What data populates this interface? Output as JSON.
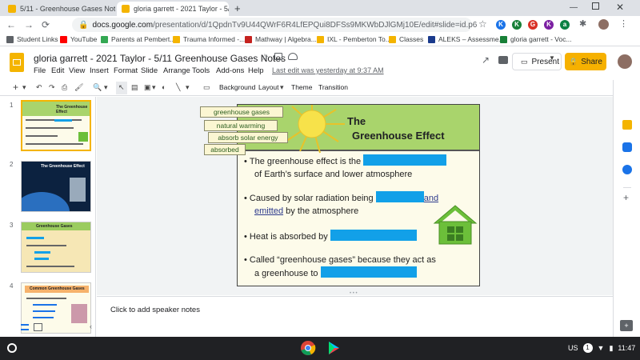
{
  "browser": {
    "tabs": [
      {
        "label": "5/11 - Greenhouse Gases Notes",
        "close": "×",
        "favicon_color": "#f4b400"
      },
      {
        "label": "gloria garrett - 2021 Taylor - 5/1",
        "close": "×",
        "favicon_color": "#f4b400"
      }
    ],
    "new_tab": "+",
    "url_host": "docs.google.com",
    "url_path": "/presentation/d/1QpdnTv9U44QWrF6R4LfEPQui8DFSs9MKWbDJlGMj10E/edit#slide=id.p6",
    "extensions": [
      {
        "letter": "K",
        "color": "#1a73e8"
      },
      {
        "letter": "K",
        "color": "#188038"
      },
      {
        "letter": "G",
        "color": "#d93025"
      },
      {
        "letter": "K",
        "color": "#7b1fa2"
      },
      {
        "letter": "a",
        "color": "#0b8043"
      }
    ]
  },
  "bookmarks": [
    {
      "label": "Student Links",
      "color": "#5f6368"
    },
    {
      "label": "YouTube",
      "color": "#ff0000"
    },
    {
      "label": "Parents at Pembert...",
      "color": "#34a853"
    },
    {
      "label": "Trauma Informed -...",
      "color": "#f4b400"
    },
    {
      "label": "Mathway | Algebra...",
      "color": "#c5221f"
    },
    {
      "label": "IXL - Pemberton To...",
      "color": "#f4b400"
    },
    {
      "label": "Classes",
      "color": "#f4b400"
    },
    {
      "label": "ALEKS – Assessme...",
      "color": "#1a3a8c"
    },
    {
      "label": "gloria garrett - Voc...",
      "color": "#188038"
    }
  ],
  "doc": {
    "title": "gloria garrett - 2021 Taylor - 5/11 Greenhouse Gases Notes",
    "menus": [
      "File",
      "Edit",
      "View",
      "Insert",
      "Format",
      "Slide",
      "Arrange",
      "Tools",
      "Add-ons",
      "Help"
    ],
    "last_edit": "Last edit was yesterday at 9:37 AM",
    "present_label": "Present",
    "share_label": "Share"
  },
  "toolbar": {
    "background_label": "Background",
    "layout_label": "Layout",
    "theme_label": "Theme",
    "transition_label": "Transition"
  },
  "filmstrip": {
    "slide_numbers": [
      "1",
      "2",
      "3",
      "4"
    ],
    "thumb1": {
      "title": "The Greenhouse Effect"
    },
    "thumb2": {
      "title": "The Greenhouse Effect"
    },
    "thumb3": {
      "title": "Greenhouse Gases"
    },
    "thumb4": {
      "title": "Common Greenhouse Gases"
    }
  },
  "slide": {
    "title_line1": "The",
    "title_line2": "Greenhouse Effect",
    "word_bank": [
      "greenhouse gases",
      "natural warming",
      "absorb solar energy",
      "absorbed"
    ],
    "bullets": {
      "b1_line1": "The greenhouse effect is the",
      "b1_line2": "of Earth’s surface and lower atmosphere",
      "b2_line1a": "Caused by solar radiation being",
      "b2_line1b": "and",
      "b2_line2a": "emitted",
      "b2_line2b": "by the atmosphere",
      "b3": "Heat is absorbed by",
      "b4_line1": "Called “greenhouse gases” because they act as",
      "b4_line2": "a greenhouse to"
    },
    "bullet_mark": "•",
    "colors": {
      "title_bar": "#a9d46c",
      "blank": "#12a0e8",
      "house": "#6cbf3a",
      "sun": "#f7e24a"
    }
  },
  "notes": {
    "placeholder": "Click to add speaker notes"
  },
  "taskbar": {
    "locale": "US",
    "time": "11:47",
    "notification_count": "1"
  }
}
